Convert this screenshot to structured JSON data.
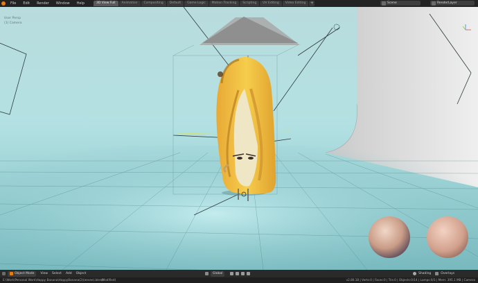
{
  "menu": [
    "File",
    "Edit",
    "Render",
    "Window",
    "Help"
  ],
  "tabs": [
    {
      "label": "3D View Full",
      "active": true
    },
    {
      "label": "Animation",
      "active": false
    },
    {
      "label": "Compositing",
      "active": false
    },
    {
      "label": "Default",
      "active": false
    },
    {
      "label": "Game Logic",
      "active": false
    },
    {
      "label": "Motion Tracking",
      "active": false
    },
    {
      "label": "Scripting",
      "active": false
    },
    {
      "label": "UV Editing",
      "active": false
    },
    {
      "label": "Video Editing",
      "active": false
    }
  ],
  "tab_add": "+",
  "scene": {
    "value": "Scene"
  },
  "render_layer": {
    "value": "RenderLayer"
  },
  "viewport": {
    "view_label": "User Persp",
    "camera_label": "(1) Camera"
  },
  "bottom": {
    "mode": "Object Mode",
    "view": "View",
    "select": "Select",
    "add": "Add",
    "object": "Object",
    "transform_orientation": "Global",
    "shading": "Shading",
    "overlays": "Overlays"
  },
  "status": {
    "filepath": "E:\\Work\\Personal Work\\Happy Banana\\HappyBanana(2)(eevee).blend",
    "modified": "(Modified)",
    "stats": "v2.80.18 | Verts:0 | Faces:0 | Tris:0 | Objects:0/14 | Lamps:0/3 | Mem: 395.1 MB | Camera"
  },
  "colors": {
    "accent": "#e87d0d",
    "viewport_floor": "#9fd9dc",
    "banana_yellow": "#f2c043"
  }
}
